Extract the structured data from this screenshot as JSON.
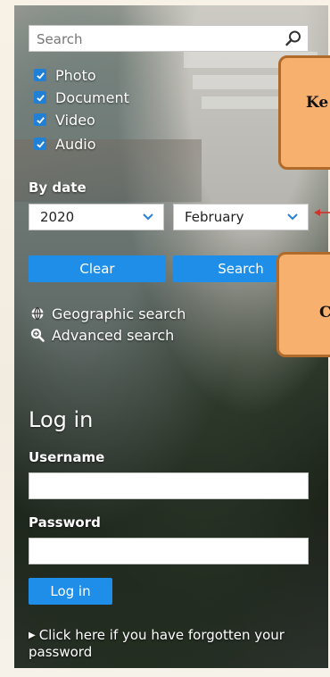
{
  "search": {
    "placeholder": "Search"
  },
  "media_types": [
    {
      "label": "Photo",
      "checked": true
    },
    {
      "label": "Document",
      "checked": true
    },
    {
      "label": "Video",
      "checked": true
    },
    {
      "label": "Audio",
      "checked": true
    }
  ],
  "date_filter": {
    "heading": "By date",
    "year_value": "2020",
    "month_value": "February"
  },
  "actions": {
    "clear_label": "Clear",
    "search_label": "Search"
  },
  "links": {
    "geographic_label": "Geographic search",
    "advanced_label": "Advanced search"
  },
  "login": {
    "title": "Log in",
    "username_label": "Username",
    "password_label": "Password",
    "submit_label": "Log in",
    "forgot_label": "Click here if you have forgotten your password"
  },
  "callouts": [
    {
      "text": "Ke"
    },
    {
      "text": "C"
    }
  ],
  "colors": {
    "accent_blue": "#1f8ee8",
    "checkbox_blue": "#1f80d6",
    "callout_fill": "#f7b06e",
    "callout_border": "#b06a2a",
    "arrow_red": "#d0342c"
  },
  "icons": [
    "search-icon",
    "check-icon",
    "chevron-down-icon",
    "globe-icon",
    "zoom-icon",
    "triangle-right-icon",
    "arrow-left-icon"
  ]
}
